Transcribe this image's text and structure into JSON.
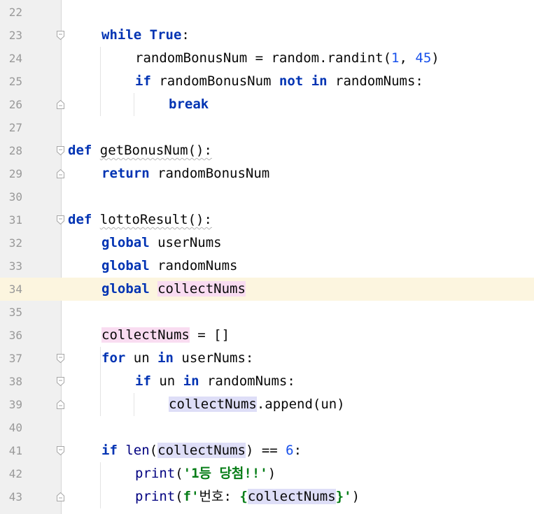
{
  "editor": {
    "current_line": 34,
    "lines": [
      {
        "n": "22",
        "indent": 0,
        "fold": "none",
        "tokens": []
      },
      {
        "n": "23",
        "indent": 1,
        "fold": "open",
        "tokens": [
          {
            "t": "while",
            "c": "kw"
          },
          {
            "t": " "
          },
          {
            "t": "True",
            "c": "kw"
          },
          {
            "t": ":"
          }
        ]
      },
      {
        "n": "24",
        "indent": 2,
        "fold": "none",
        "tokens": [
          {
            "t": "randomBonusNum = random.randint("
          },
          {
            "t": "1",
            "c": "num"
          },
          {
            "t": ", "
          },
          {
            "t": "45",
            "c": "num"
          },
          {
            "t": ")"
          }
        ]
      },
      {
        "n": "25",
        "indent": 2,
        "fold": "none",
        "tokens": [
          {
            "t": "if",
            "c": "kw"
          },
          {
            "t": " randomBonusNum "
          },
          {
            "t": "not",
            "c": "kw"
          },
          {
            "t": " "
          },
          {
            "t": "in",
            "c": "kw"
          },
          {
            "t": " randomNums:"
          }
        ]
      },
      {
        "n": "26",
        "indent": 3,
        "fold": "close",
        "tokens": [
          {
            "t": "break",
            "c": "kw"
          }
        ]
      },
      {
        "n": "27",
        "indent": 0,
        "fold": "none",
        "tokens": []
      },
      {
        "n": "28",
        "indent": 0,
        "fold": "open",
        "tokens": [
          {
            "t": "def",
            "c": "kw"
          },
          {
            "t": " "
          },
          {
            "t": "getBonusNum():",
            "c": "sq"
          }
        ]
      },
      {
        "n": "29",
        "indent": 1,
        "fold": "close",
        "tokens": [
          {
            "t": "return",
            "c": "kw"
          },
          {
            "t": " randomBonusNum"
          }
        ]
      },
      {
        "n": "30",
        "indent": 0,
        "fold": "none",
        "tokens": []
      },
      {
        "n": "31",
        "indent": 0,
        "fold": "open",
        "tokens": [
          {
            "t": "def",
            "c": "kw"
          },
          {
            "t": " "
          },
          {
            "t": "lottoResult():",
            "c": "sq"
          }
        ]
      },
      {
        "n": "32",
        "indent": 1,
        "fold": "none",
        "tokens": [
          {
            "t": "global",
            "c": "kw"
          },
          {
            "t": " userNums"
          }
        ]
      },
      {
        "n": "33",
        "indent": 1,
        "fold": "none",
        "tokens": [
          {
            "t": "global",
            "c": "kw"
          },
          {
            "t": " randomNums"
          }
        ]
      },
      {
        "n": "34",
        "indent": 1,
        "fold": "none",
        "tokens": [
          {
            "t": "global",
            "c": "kw"
          },
          {
            "t": " "
          },
          {
            "t": "collectNums",
            "c": "hl-write"
          }
        ]
      },
      {
        "n": "35",
        "indent": 0,
        "fold": "none",
        "tokens": []
      },
      {
        "n": "36",
        "indent": 1,
        "fold": "none",
        "tokens": [
          {
            "t": "collectNums",
            "c": "hl-write"
          },
          {
            "t": " = []"
          }
        ]
      },
      {
        "n": "37",
        "indent": 1,
        "fold": "open",
        "tokens": [
          {
            "t": "for",
            "c": "kw"
          },
          {
            "t": " un "
          },
          {
            "t": "in",
            "c": "kw"
          },
          {
            "t": " userNums:"
          }
        ]
      },
      {
        "n": "38",
        "indent": 2,
        "fold": "open",
        "tokens": [
          {
            "t": "if",
            "c": "kw"
          },
          {
            "t": " un "
          },
          {
            "t": "in",
            "c": "kw"
          },
          {
            "t": " randomNums:"
          }
        ]
      },
      {
        "n": "39",
        "indent": 3,
        "fold": "close",
        "tokens": [
          {
            "t": "collectNums",
            "c": "hl-read"
          },
          {
            "t": ".append(un)"
          }
        ]
      },
      {
        "n": "40",
        "indent": 0,
        "fold": "none",
        "tokens": []
      },
      {
        "n": "41",
        "indent": 1,
        "fold": "open",
        "tokens": [
          {
            "t": "if",
            "c": "kw"
          },
          {
            "t": " "
          },
          {
            "t": "len",
            "c": "bi"
          },
          {
            "t": "("
          },
          {
            "t": "collectNums",
            "c": "hl-read"
          },
          {
            "t": ") == "
          },
          {
            "t": "6",
            "c": "num"
          },
          {
            "t": ":"
          }
        ]
      },
      {
        "n": "42",
        "indent": 2,
        "fold": "none",
        "tokens": [
          {
            "t": "print",
            "c": "bi"
          },
          {
            "t": "("
          },
          {
            "t": "'1등 당첨!!'",
            "c": "str"
          },
          {
            "t": ")"
          }
        ]
      },
      {
        "n": "43",
        "indent": 2,
        "fold": "close",
        "tokens": [
          {
            "t": "print",
            "c": "bi"
          },
          {
            "t": "("
          },
          {
            "t": "f'",
            "c": "str"
          },
          {
            "t": "번호: "
          },
          {
            "t": "{",
            "c": "str"
          },
          {
            "t": "collectNums",
            "c": "hl-read"
          },
          {
            "t": "}",
            "c": "str"
          },
          {
            "t": "'",
            "c": "str"
          },
          {
            "t": ")"
          }
        ]
      }
    ]
  },
  "colors": {
    "keyword": "#0033b3",
    "number": "#1750eb",
    "string": "#067d17",
    "builtin": "#000080",
    "current_line": "#fcf5df",
    "write_highlight": "#f9dcf1",
    "read_highlight": "#dedef7",
    "gutter": "#f0f0f0"
  },
  "icons": {
    "fold_open": "fold-open-icon",
    "fold_close": "fold-close-icon"
  }
}
